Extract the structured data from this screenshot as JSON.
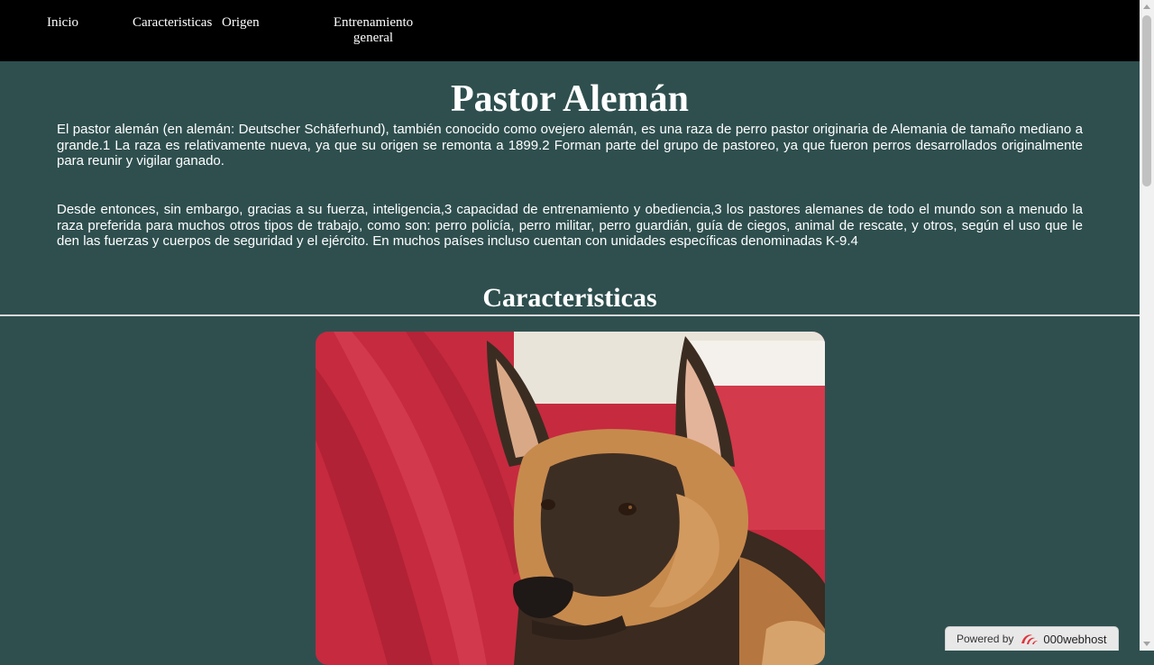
{
  "nav": {
    "items": [
      {
        "label": "Inicio"
      },
      {
        "label": "Caracteristicas"
      },
      {
        "label": "Origen"
      },
      {
        "label": "Entrenamiento general"
      }
    ]
  },
  "main": {
    "title": "Pastor Alemán",
    "paragraphs": [
      "El pastor alemán (en alemán: Deutscher Schäferhund), también conocido como ovejero alemán, es una raza de perro pastor originaria de Alemania de tamaño mediano a grande.1 La raza es relativamente nueva, ya que su origen se remonta a 1899.2 Forman parte del grupo de pastoreo, ya que fueron perros desarrollados originalmente para reunir y vigilar ganado.",
      "Desde entonces, sin embargo, gracias a su fuerza, inteligencia,3 capacidad de entrenamiento y obediencia,3 los pastores alemanes de todo el mundo son a menudo la raza preferida para muchos otros tipos de trabajo, como son: perro policía, perro militar, perro guardián, guía de ciegos, animal de rescate, y otros, según el uso que le den las fuerzas y cuerpos de seguridad y el ejército. En muchos países incluso cuentan con unidades específicas denominadas K-9.4"
    ],
    "section_title": "Caracteristicas"
  },
  "badge": {
    "powered_label": "Powered by",
    "brand": "000webhost",
    "icon": "000webhost-logo-icon"
  },
  "colors": {
    "nav_bg": "#000000",
    "page_bg": "#2f4f4f",
    "text": "#ffffff"
  }
}
